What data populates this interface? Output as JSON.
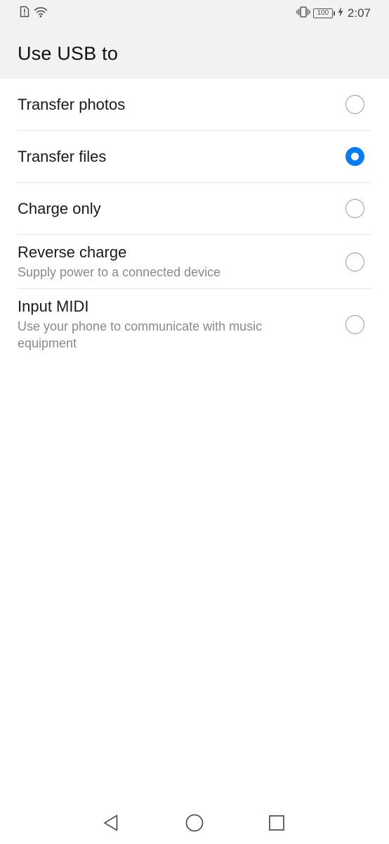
{
  "status_bar": {
    "battery_level": "100",
    "time": "2:07",
    "icons": [
      "sim-alert-icon",
      "wifi-icon",
      "vibrate-icon",
      "battery-icon",
      "charging-icon"
    ]
  },
  "page": {
    "title": "Use USB to"
  },
  "options": [
    {
      "label": "Transfer photos",
      "sub": "",
      "selected": false
    },
    {
      "label": "Transfer files",
      "sub": "",
      "selected": true
    },
    {
      "label": "Charge only",
      "sub": "",
      "selected": false
    },
    {
      "label": "Reverse charge",
      "sub": "Supply power to a connected device",
      "selected": false
    },
    {
      "label": "Input MIDI",
      "sub": "Use your phone to communicate with music equipment",
      "selected": false
    }
  ],
  "nav": {
    "icons": [
      "back-icon",
      "home-icon",
      "recents-icon"
    ]
  },
  "colors": {
    "accent": "#0a7cf2",
    "header_bg": "#f2f2f2",
    "divider": "#e6e6e6",
    "secondary_text": "#8a8a8a"
  }
}
